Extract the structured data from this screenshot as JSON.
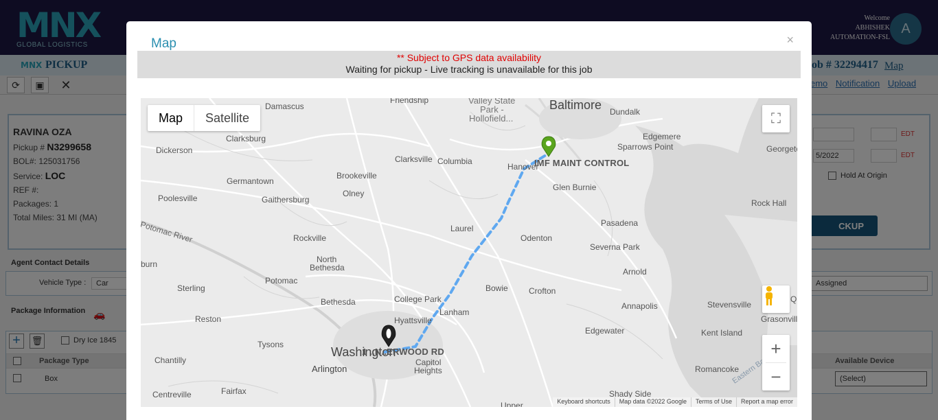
{
  "app": {
    "logo_text": "MNX",
    "logo_subtitle": "GLOBAL LOGISTICS",
    "welcome": "Welcome",
    "user_name": "ABHISHEK",
    "user_org": "AUTOMATION-FSL",
    "avatar_letter": "A"
  },
  "subheader": {
    "logo": "MNX",
    "title": "PICKUP",
    "job_number": "ob # 32294417",
    "map_link": "Map"
  },
  "toolbar": {
    "links": [
      "emo",
      "Notification",
      "Upload"
    ]
  },
  "pickup_panel": {
    "name": "RAVINA OZA",
    "pickup_label": "Pickup #",
    "pickup_value": "N3299658",
    "bol": "BOL#: 125031756",
    "service_label": "Service:",
    "service_value": "LOC",
    "ref": "REF #:",
    "packages": "Packages: 1",
    "miles_label": "Total Miles:",
    "miles_value": "31  MI  (MA)"
  },
  "right_panel": {
    "date2": "5/2022",
    "edt": "EDT",
    "hold_at_origin": "Hold At Origin",
    "pickup_button": "CKUP"
  },
  "agent_contact": {
    "label": "Agent Contact Details",
    "vehicle_type_label": "Vehicle Type :",
    "vehicle_type_value": "Car",
    "status_select": "Assigned"
  },
  "package_info": {
    "label": "Package Information",
    "dry_ice": "Dry Ice 1845",
    "header_package_type": "Package Type",
    "header_available_device": "Available Device",
    "row_package_type": "Box",
    "row_device": "(Select)"
  },
  "modal": {
    "title": "Map",
    "close": "×",
    "gps_notice": "** Subject to GPS data availability",
    "status_message": "Waiting for pickup - Live tracking is unavailable for this job"
  },
  "map": {
    "type_map": "Map",
    "type_satellite": "Satellite",
    "destination_label": "IMF MAINT CONTROL",
    "origin_label": "1 ..N..ERWOOD RD",
    "places": {
      "baltimore": "Baltimore",
      "washington": "Washington",
      "damascus": "Damascus",
      "friendship": "Friendship",
      "valley_state": "Valley State",
      "park": "Park -",
      "hollofield": "Hollofield...",
      "dundalk": "Dundalk",
      "edgemere": "Edgemere",
      "sparrows_point": "Sparrows Point",
      "georgetown": "Georgeto",
      "clarksburg": "Clarksburg",
      "dickerson": "Dickerson",
      "clarksville": "Clarksville",
      "columbia": "Columbia",
      "hanover": "Hanover",
      "germantown": "Germantown",
      "brookeville": "Brookeville",
      "glen_burnie": "Glen Burnie",
      "poolesville": "Poolesville",
      "gaithersburg": "Gaithersburg",
      "olney": "Olney",
      "rock_hall": "Rock Hall",
      "laurel": "Laurel",
      "pasadena": "Pasadena",
      "potomac_river": "Potomac River",
      "rockville": "Rockville",
      "odenton": "Odenton",
      "severna_park": "Severna Park",
      "north_bethesda": "North",
      "north_bethesda2": "Bethesda",
      "burn": "burn",
      "arnold": "Arnold",
      "sterling": "Sterling",
      "potomac": "Potomac",
      "bowie": "Bowie",
      "crofton": "Crofton",
      "college_park": "College Park",
      "bethesda": "Bethesda",
      "lanham": "Lanham",
      "annapolis": "Annapolis",
      "stevensville": "Stevensville",
      "que": "Que",
      "reston": "Reston",
      "hyattsville": "Hyattsville",
      "grasonville": "Grasonville",
      "edgewater": "Edgewater",
      "kent_island": "Kent Island",
      "tysons": "Tysons",
      "capitol": "Capitol",
      "heights": "Heights",
      "chantilly": "Chantilly",
      "arlington": "Arlington",
      "romancoke": "Romancoke",
      "eastern_bay": "Eastern Ba",
      "centreville": "Centreville",
      "fairfax": "Fairfax",
      "shady_side": "Shady Side",
      "upper": "Upper"
    },
    "footer": {
      "shortcuts": "Keyboard shortcuts",
      "data": "Map data ©2022 Google",
      "terms": "Terms of Use",
      "report": "Report a map error"
    },
    "colors": {
      "route": "#5fa8f0",
      "destination_pin": "#5aa51e",
      "origin_pin": "#222222",
      "water": "#d6d6d6",
      "land": "#ebebeb"
    }
  }
}
